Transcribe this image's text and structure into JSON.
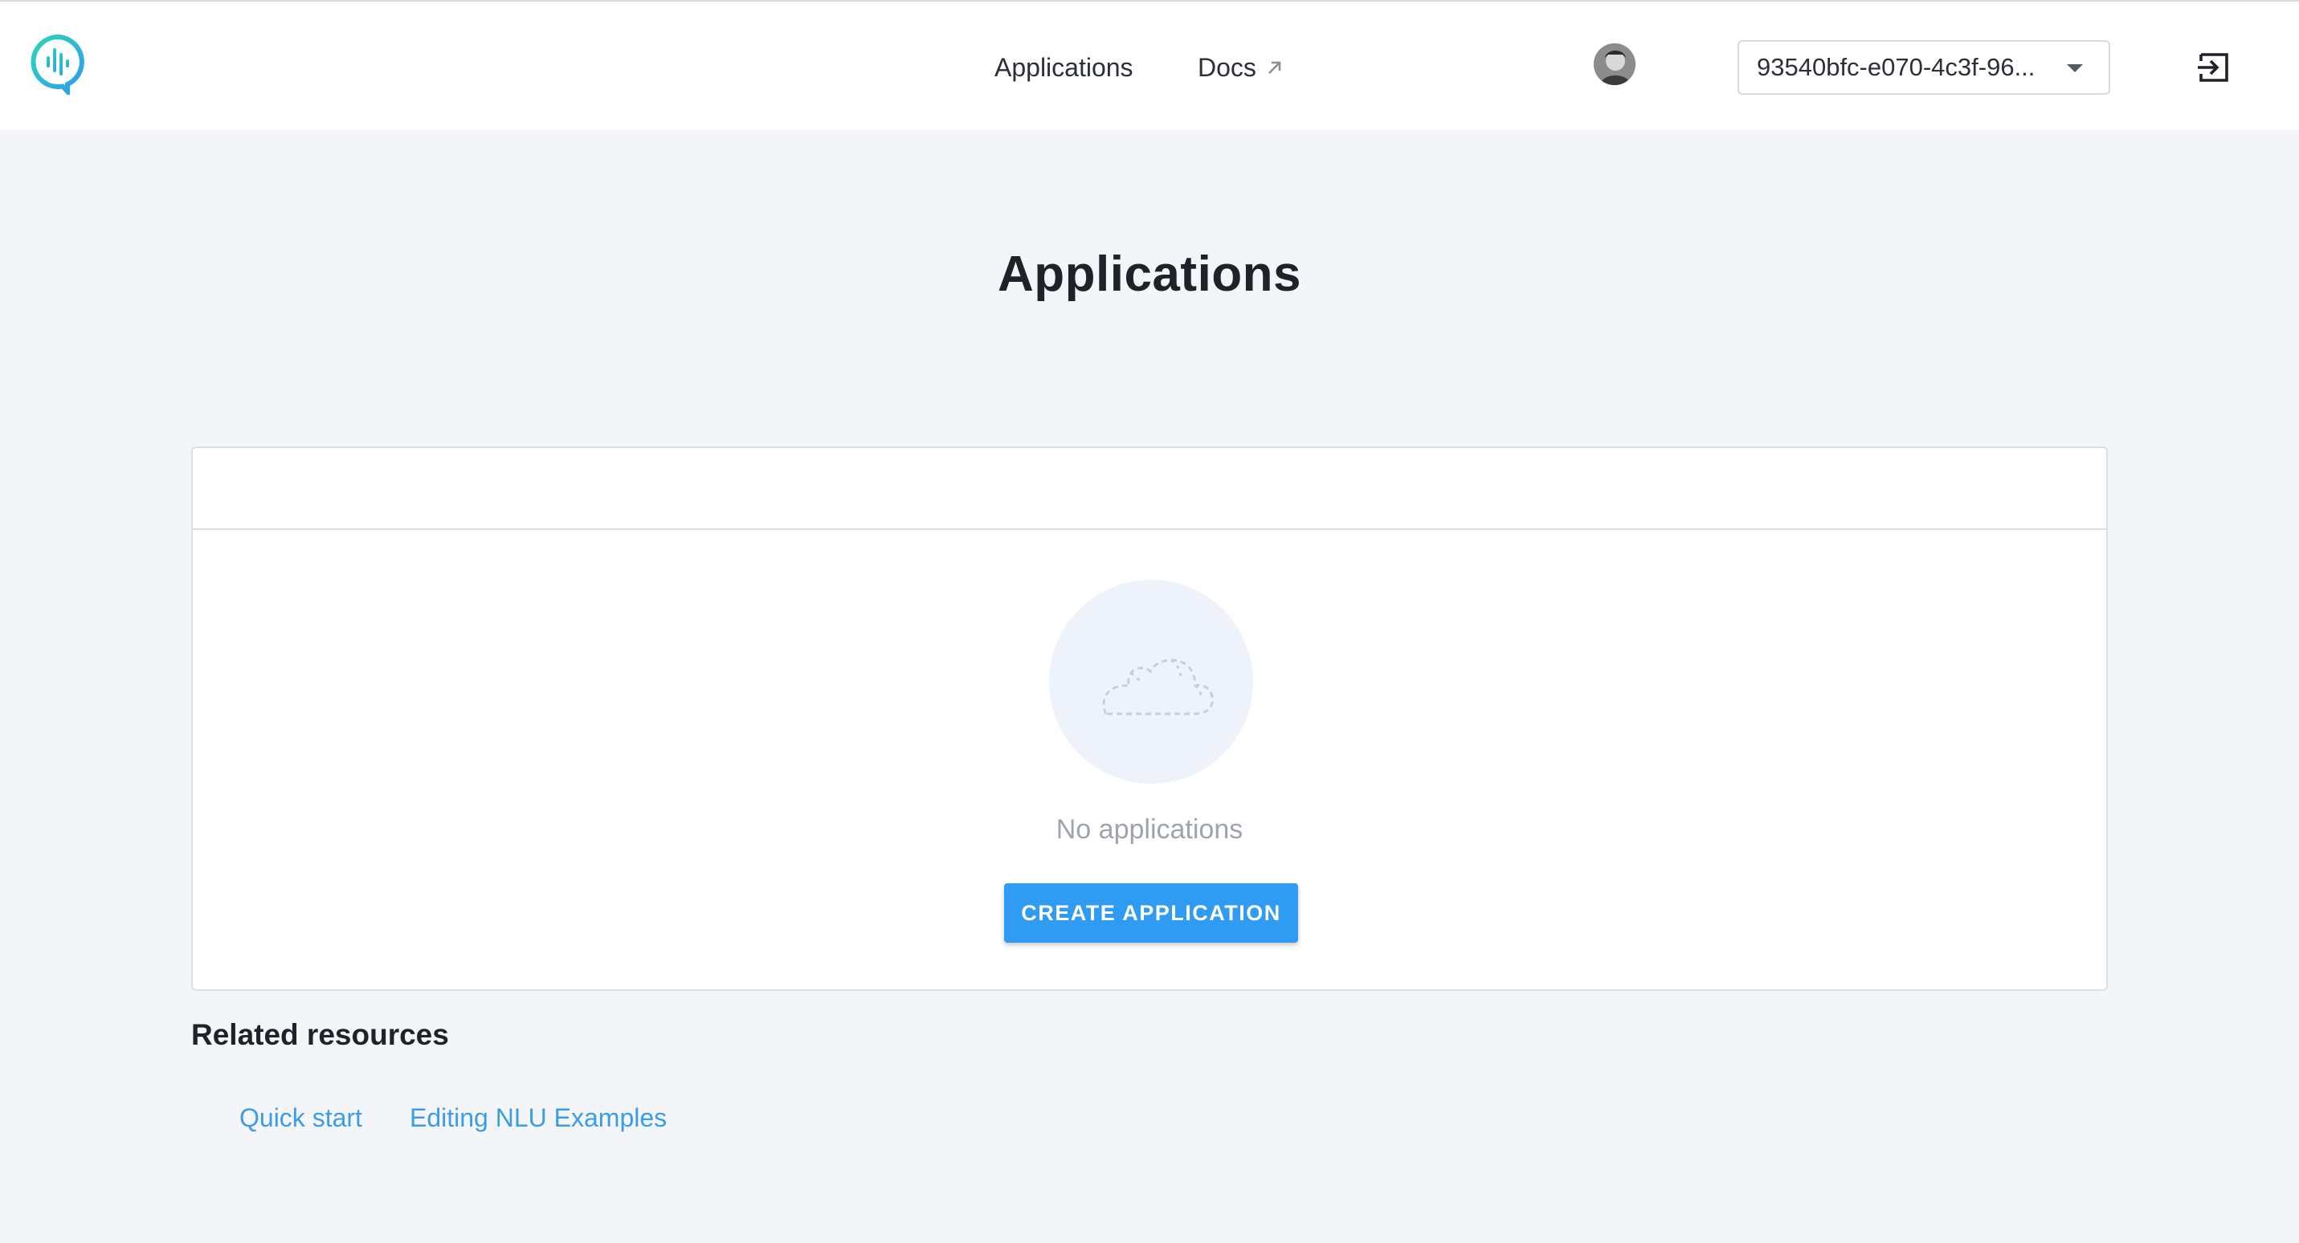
{
  "header": {
    "nav": [
      {
        "label": "Applications"
      },
      {
        "label": "Docs"
      }
    ],
    "project_select": {
      "value": "93540bfc-e070-4c3f-96..."
    },
    "colors": {
      "logo_gradient_start": "#2bd6b4",
      "logo_gradient_end": "#2f9bf3"
    }
  },
  "main": {
    "title": "Applications",
    "empty_state": {
      "message": "No applications",
      "create_button_label": "CREATE APPLICATION"
    }
  },
  "related": {
    "title": "Related resources",
    "links": [
      {
        "label": "Quick start"
      },
      {
        "label": "Editing NLU Examples"
      }
    ]
  },
  "colors": {
    "accent": "#2f9bf3",
    "page_background": "#f4f5f9",
    "link": "#3b9ce8"
  }
}
